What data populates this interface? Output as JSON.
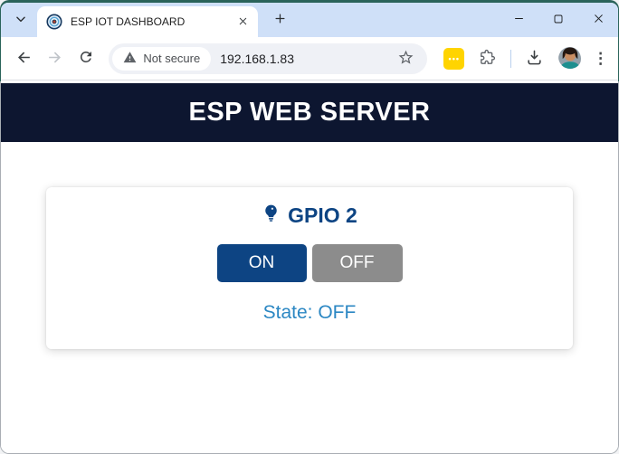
{
  "browser": {
    "tab_title": "ESP IOT DASHBOARD",
    "security_label": "Not secure",
    "url": "192.168.1.83"
  },
  "page": {
    "header_title": "ESP WEB SERVER",
    "card": {
      "title": "GPIO 2",
      "on_label": "ON",
      "off_label": "OFF",
      "state_text": "State: OFF"
    }
  },
  "icons": {
    "menu_dots": "⋮",
    "extension_badge_dots": "•••"
  },
  "colors": {
    "frame_teal": "#2a635a",
    "tabstrip_bg": "#cfe0f8",
    "header_navy": "#0d1630",
    "accent_blue": "#0d4483",
    "state_blue": "#2b87c3",
    "off_gray": "#8c8c8c",
    "extension_badge_yellow": "#ffd400"
  }
}
